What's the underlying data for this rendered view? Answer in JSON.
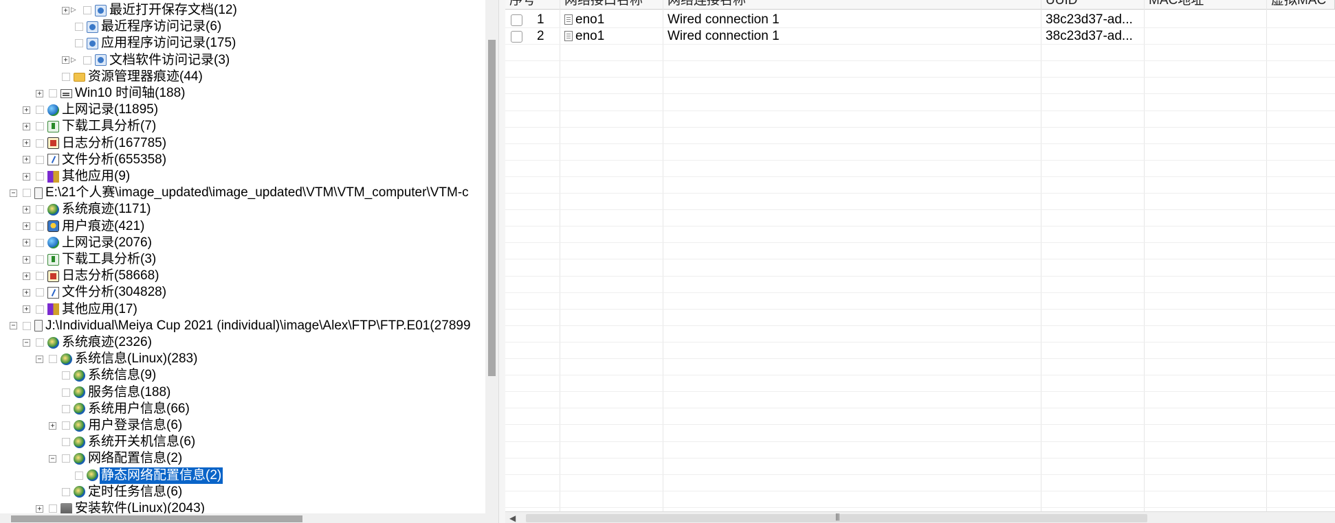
{
  "tree": {
    "items": [
      {
        "label": "最近打开保存文档(12)",
        "icon": "document-history-icon",
        "expandable": true
      },
      {
        "label": "最近程序访问记录(6)",
        "icon": "document-history-icon",
        "expandable": false
      },
      {
        "label": "应用程序访问记录(175)",
        "icon": "document-history-icon",
        "expandable": false
      },
      {
        "label": "文档软件访问记录(3)",
        "icon": "document-history-icon",
        "expandable": true
      },
      {
        "label": "资源管理器痕迹(44)",
        "icon": "folder-icon",
        "expandable": false
      },
      {
        "label": "Win10 时间轴(188)",
        "icon": "timeline-icon",
        "expandable": true
      },
      {
        "label": "上网记录(11895)",
        "icon": "globe-icon",
        "expandable": true
      },
      {
        "label": "下载工具分析(7)",
        "icon": "download-icon",
        "expandable": true
      },
      {
        "label": "日志分析(167785)",
        "icon": "log-icon",
        "expandable": true
      },
      {
        "label": "文件分析(655358)",
        "icon": "file-analysis-icon",
        "expandable": true
      },
      {
        "label": "其他应用(9)",
        "icon": "apps-icon",
        "expandable": true
      },
      {
        "label": "E:\\21个人赛\\image_updated\\image_updated\\VTM\\VTM_computer\\VTM-c",
        "icon": "drive-icon",
        "expandable": true,
        "expanded": true
      },
      {
        "label": "系统痕迹(1171)",
        "icon": "system-trace-icon",
        "expandable": true
      },
      {
        "label": "用户痕迹(421)",
        "icon": "user-trace-icon",
        "expandable": true
      },
      {
        "label": "上网记录(2076)",
        "icon": "globe-icon",
        "expandable": true
      },
      {
        "label": "下载工具分析(3)",
        "icon": "download-icon",
        "expandable": true
      },
      {
        "label": "日志分析(58668)",
        "icon": "log-icon",
        "expandable": true
      },
      {
        "label": "文件分析(304828)",
        "icon": "file-analysis-icon",
        "expandable": true
      },
      {
        "label": "其他应用(17)",
        "icon": "apps-icon",
        "expandable": true
      },
      {
        "label": "J:\\Individual\\Meiya Cup 2021 (individual)\\image\\Alex\\FTP\\FTP.E01(27899",
        "icon": "drive-icon",
        "expandable": true,
        "expanded": true
      },
      {
        "label": "系统痕迹(2326)",
        "icon": "system-trace-icon",
        "expandable": true,
        "expanded": true
      },
      {
        "label": "系统信息(Linux)(283)",
        "icon": "system-trace-icon",
        "expandable": true,
        "expanded": true
      },
      {
        "label": "系统信息(9)",
        "icon": "system-trace-icon",
        "expandable": false
      },
      {
        "label": "服务信息(188)",
        "icon": "system-trace-icon",
        "expandable": false
      },
      {
        "label": "系统用户信息(66)",
        "icon": "system-trace-icon",
        "expandable": false
      },
      {
        "label": "用户登录信息(6)",
        "icon": "system-trace-icon",
        "expandable": true
      },
      {
        "label": "系统开关机信息(6)",
        "icon": "system-trace-icon",
        "expandable": false
      },
      {
        "label": "网络配置信息(2)",
        "icon": "system-trace-icon",
        "expandable": true,
        "expanded": true
      },
      {
        "label": "静态网络配置信息(2)",
        "icon": "system-trace-icon",
        "expandable": false,
        "selected": true
      },
      {
        "label": "定时任务信息(6)",
        "icon": "system-trace-icon",
        "expandable": false
      },
      {
        "label": "安装软件(Linux)(2043)",
        "icon": "install-icon",
        "expandable": true
      }
    ]
  },
  "grid": {
    "columns": [
      "序号",
      "网络接口名称",
      "网络连接名称",
      "UUID",
      "MAC地址",
      "虚拟MAC"
    ],
    "rows": [
      {
        "index": "1",
        "interface": "eno1",
        "connection": "Wired connection 1",
        "uuid": "38c23d37-ad...",
        "mac": "",
        "vmac": ""
      },
      {
        "index": "2",
        "interface": "eno1",
        "connection": "Wired connection 1",
        "uuid": "38c23d37-ad...",
        "mac": "",
        "vmac": ""
      }
    ],
    "empty_row_count": 28
  },
  "colors": {
    "selection": "#0a64c8",
    "header_bg": "#f7f7f7",
    "grid_line": "#e6e6e6"
  }
}
